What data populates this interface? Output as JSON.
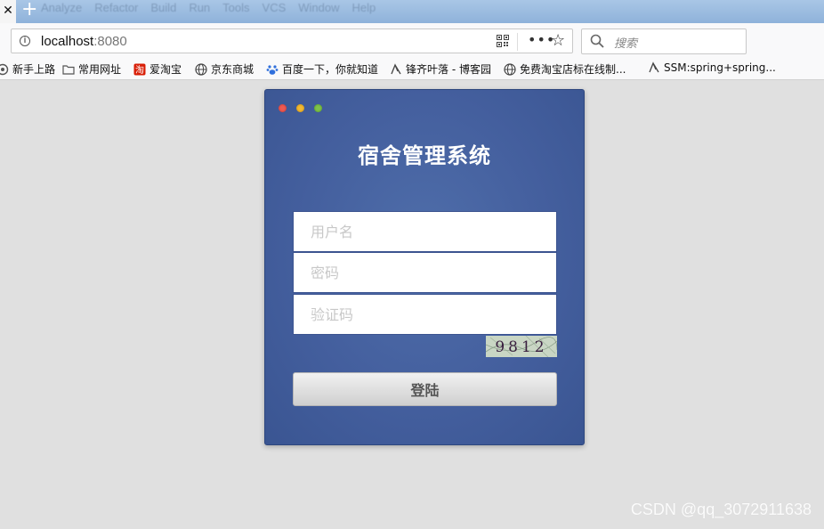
{
  "browser": {
    "ghost_menu": [
      "Analyze",
      "Refactor",
      "Build",
      "Run",
      "Tools",
      "VCS",
      "Window",
      "Help"
    ],
    "url": {
      "host": "localhost",
      "port": ":8080"
    },
    "search_placeholder": "搜索",
    "icons": {
      "tab_close": "✕",
      "new_tab": "+",
      "info": "i",
      "more": "•••",
      "star": "☆"
    }
  },
  "bookmarks": [
    {
      "label": "新手上路",
      "icon": "firefox-icon"
    },
    {
      "label": "常用网址",
      "icon": "folder-icon"
    },
    {
      "label": "爱淘宝",
      "icon": "taobao-icon"
    },
    {
      "label": "京东商城",
      "icon": "globe-icon"
    },
    {
      "label": "百度一下，你就知道",
      "icon": "baidu-paw-icon"
    },
    {
      "label": "锋齐叶落 - 博客园",
      "icon": "blog-icon"
    },
    {
      "label": "免费淘宝店标在线制...",
      "icon": "globe-icon"
    },
    {
      "label": "SSM:spring+spring...",
      "icon": "blog-icon"
    }
  ],
  "login": {
    "title": "宿舍管理系统",
    "username_placeholder": "用户名",
    "password_placeholder": "密码",
    "captcha_placeholder": "验证码",
    "captcha_code": "9812",
    "submit_label": "登陆"
  },
  "colors": {
    "card": "#445f9e",
    "tab_strip": "#9dbde2",
    "page_bg": "#e0e0e0"
  },
  "watermark": "CSDN @qq_3072911638"
}
